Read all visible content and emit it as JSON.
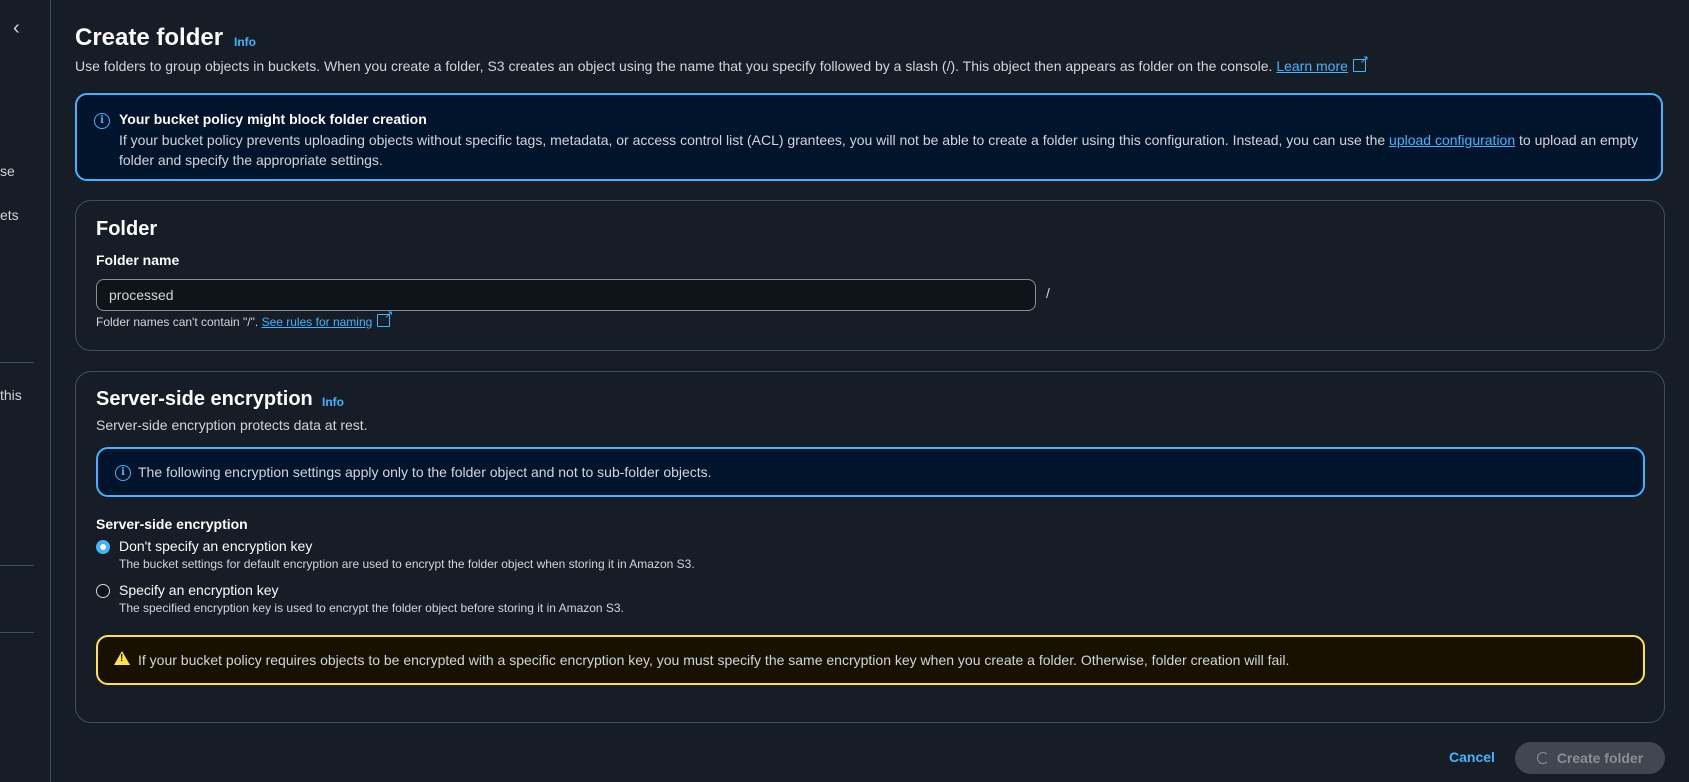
{
  "sidebar": {
    "fragments": [
      "se",
      "ets",
      "this"
    ]
  },
  "header": {
    "title": "Create folder",
    "info": "Info",
    "description": "Use folders to group objects in buckets. When you create a folder, S3 creates an object using the name that you specify followed by a slash (/). This object then appears as folder on the console.",
    "learn_more": "Learn more"
  },
  "policy_alert": {
    "title": "Your bucket policy might block folder creation",
    "body_before": "If your bucket policy prevents uploading objects without specific tags, metadata, or access control list (ACL) grantees, you will not be able to create a folder using this configuration. Instead, you can use the",
    "link": "upload configuration",
    "body_after": "to upload an empty folder and specify the appropriate settings."
  },
  "folder": {
    "heading": "Folder",
    "name_label": "Folder name",
    "name_value": "processed",
    "slash": "/",
    "hint": "Folder names can't contain \"/\".",
    "hint_link": "See rules for naming"
  },
  "sse": {
    "heading": "Server-side encryption",
    "info": "Info",
    "description": "Server-side encryption protects data at rest.",
    "info_alert": "The following encryption settings apply only to the folder object and not to sub-folder objects.",
    "field_label": "Server-side encryption",
    "options": [
      {
        "label": "Don't specify an encryption key",
        "description": "The bucket settings for default encryption are used to encrypt the folder object when storing it in Amazon S3.",
        "selected": true
      },
      {
        "label": "Specify an encryption key",
        "description": "The specified encryption key is used to encrypt the folder object before storing it in Amazon S3.",
        "selected": false
      }
    ],
    "warning": "If your bucket policy requires objects to be encrypted with a specific encryption key, you must specify the same encryption key when you create a folder. Otherwise, folder creation will fail."
  },
  "footer": {
    "cancel": "Cancel",
    "create": "Create folder"
  },
  "colors": {
    "background": "#161d26",
    "accent": "#42b4ff",
    "warning": "#ffe347"
  }
}
